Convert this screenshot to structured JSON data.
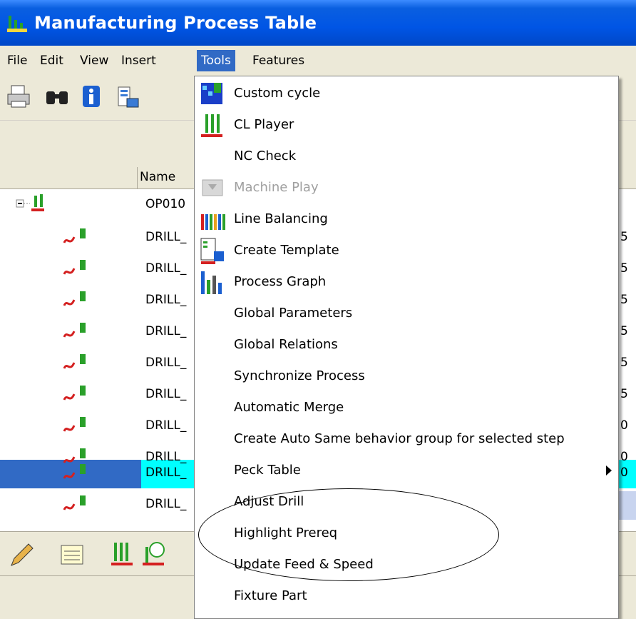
{
  "window": {
    "title": "Manufacturing Process Table"
  },
  "menubar": [
    {
      "label": "File"
    },
    {
      "label": "Edit"
    },
    {
      "label": "View"
    },
    {
      "label": "Insert"
    },
    {
      "label": "Tools"
    },
    {
      "label": "Features"
    }
  ],
  "toolbar": {
    "icons": [
      "printer-icon",
      "binoculars-icon",
      "info-icon",
      "layout-icon"
    ]
  },
  "table": {
    "column_name": "Name",
    "rows": [
      {
        "name": "OP010",
        "right": ""
      },
      {
        "name": "DRILL_",
        "right": "5"
      },
      {
        "name": "DRILL_",
        "right": "5"
      },
      {
        "name": "DRILL_",
        "right": "5"
      },
      {
        "name": "DRILL_",
        "right": "5"
      },
      {
        "name": "DRILL_",
        "right": "5"
      },
      {
        "name": "DRILL_",
        "right": "5"
      },
      {
        "name": "DRILL_",
        "right": "0"
      },
      {
        "name": "DRILL_",
        "right": "0"
      },
      {
        "name": "DRILL_",
        "right": "0"
      },
      {
        "name": "DRILL_",
        "right": ""
      }
    ]
  },
  "tools_menu": [
    {
      "label": "Custom cycle",
      "icon": "custom-cycle-icon"
    },
    {
      "label": "CL Player",
      "icon": "cl-player-icon"
    },
    {
      "label": "NC Check"
    },
    {
      "label": "Machine Play",
      "icon": "machine-play-icon",
      "disabled": true
    },
    {
      "label": "Line Balancing",
      "icon": "line-balancing-icon"
    },
    {
      "label": "Create Template",
      "icon": "create-template-icon"
    },
    {
      "label": "Process Graph",
      "icon": "process-graph-icon"
    },
    {
      "label": "Global Parameters"
    },
    {
      "label": "Global Relations"
    },
    {
      "label": "Synchronize Process"
    },
    {
      "label": "Automatic Merge"
    },
    {
      "label": "Create Auto Same behavior group for selected step"
    },
    {
      "label": "Peck Table",
      "submenu": true
    },
    {
      "label": "Adjust Drill"
    },
    {
      "label": "Highlight Prereq"
    },
    {
      "label": "Update Feed & Speed"
    },
    {
      "label": "Fixture Part"
    }
  ],
  "colors": {
    "titlebar": "#0055e5",
    "menu_highlight": "#316ac5",
    "selected_cell": "#00ffff"
  }
}
